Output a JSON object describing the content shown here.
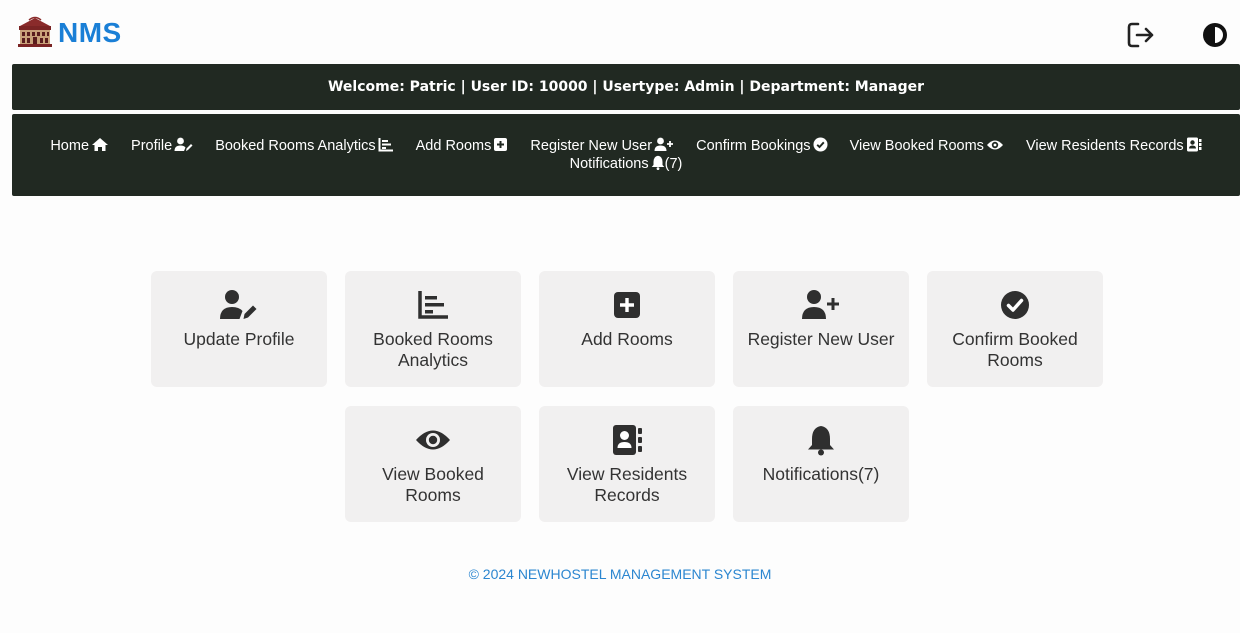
{
  "brand": {
    "name": "NMS",
    "color": "#1a7fd6"
  },
  "header_icons": [
    {
      "icon": "logout-icon"
    },
    {
      "icon": "theme-toggle-icon"
    }
  ],
  "welcome": {
    "text": "Welcome: Patric | User ID: 10000 | Usertype: Admin | Department: Manager"
  },
  "nav": {
    "items": [
      {
        "label": "Home",
        "icon": "home-icon"
      },
      {
        "label": "Profile",
        "icon": "user-edit-icon"
      },
      {
        "label": "Booked Rooms Analytics",
        "icon": "chart-icon"
      },
      {
        "label": "Add Rooms",
        "icon": "plus-square-icon"
      },
      {
        "label": "Register New User",
        "icon": "user-plus-icon"
      },
      {
        "label": "Confirm Bookings",
        "icon": "check-circle-icon"
      },
      {
        "label": "View Booked Rooms",
        "icon": "eye-icon"
      },
      {
        "label": "View Residents Records",
        "icon": "address-book-icon"
      },
      {
        "label": "Notifications",
        "icon": "bell-icon",
        "suffix": "(7)"
      }
    ]
  },
  "cards": [
    {
      "label": "Update Profile",
      "icon": "user-edit-icon"
    },
    {
      "label": "Booked Rooms Analytics",
      "icon": "chart-icon"
    },
    {
      "label": "Add Rooms",
      "icon": "plus-square-icon"
    },
    {
      "label": "Register New User",
      "icon": "user-plus-icon"
    },
    {
      "label": "Confirm Booked Rooms",
      "icon": "check-circle-icon"
    },
    {
      "label": "View Booked Rooms",
      "icon": "eye-icon"
    },
    {
      "label": "View Residents Records",
      "icon": "address-book-icon"
    },
    {
      "label": "Notifications(7)",
      "icon": "bell-icon"
    }
  ],
  "footer": {
    "text": "© 2024 NEWHOSTEL MANAGEMENT SYSTEM"
  },
  "colors": {
    "bar_bg": "#212922",
    "card_bg": "#f1f0f0",
    "footer_text": "#2b86d0"
  }
}
